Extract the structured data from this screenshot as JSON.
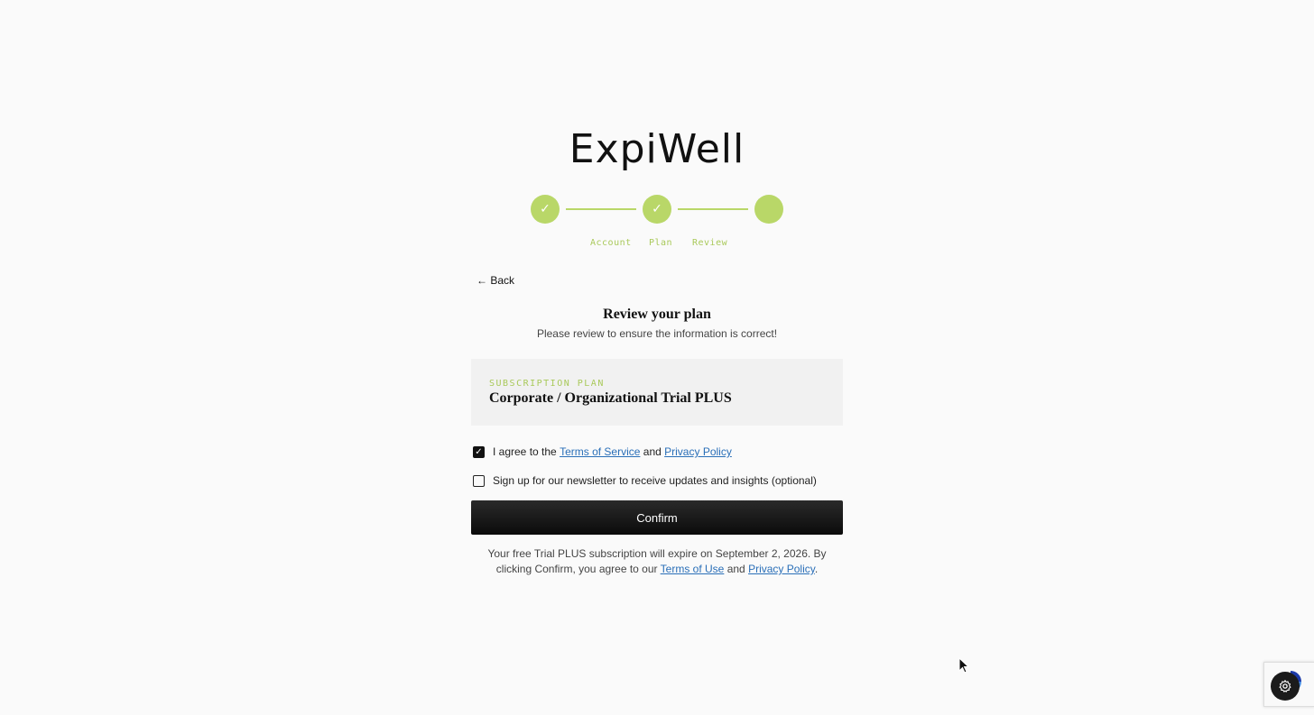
{
  "logo": {
    "text": "ExpiWell"
  },
  "steps": [
    {
      "label": "Account",
      "completed": true,
      "mark": "✓"
    },
    {
      "label": "Plan",
      "completed": true,
      "mark": "✓"
    },
    {
      "label": "Review",
      "completed": false,
      "mark": ""
    }
  ],
  "nav": {
    "back_label": "← Back"
  },
  "review": {
    "title": "Review your plan",
    "subtitle": "Please review to ensure the information is correct!"
  },
  "plan": {
    "label": "SUBSCRIPTION PLAN",
    "name": "Corporate / Organizational Trial PLUS"
  },
  "agreements": {
    "terms": {
      "checked": true,
      "prefix": "I agree to the",
      "terms_link": "Terms of Service",
      "and": "and",
      "privacy_link": "Privacy Policy"
    },
    "newsletter": {
      "checked": false,
      "label": "Sign up for our newsletter to receive updates and insights (optional)"
    }
  },
  "confirm": {
    "label": "Confirm"
  },
  "footnote": {
    "text_before": "Your free Trial PLUS subscription will expire on September 2, 2026. By clicking Confirm, you agree to our",
    "terms_link": "Terms of Use",
    "and": "and",
    "privacy_link": "Privacy Policy",
    "end": "."
  },
  "colors": {
    "accent": "#b9d768",
    "accent_text": "#a9c95a",
    "link": "#2a6fb8",
    "button": "#111111"
  },
  "icons": {
    "step_check": "check-icon",
    "settings": "gear-icon",
    "recaptcha": "recaptcha-icon"
  }
}
